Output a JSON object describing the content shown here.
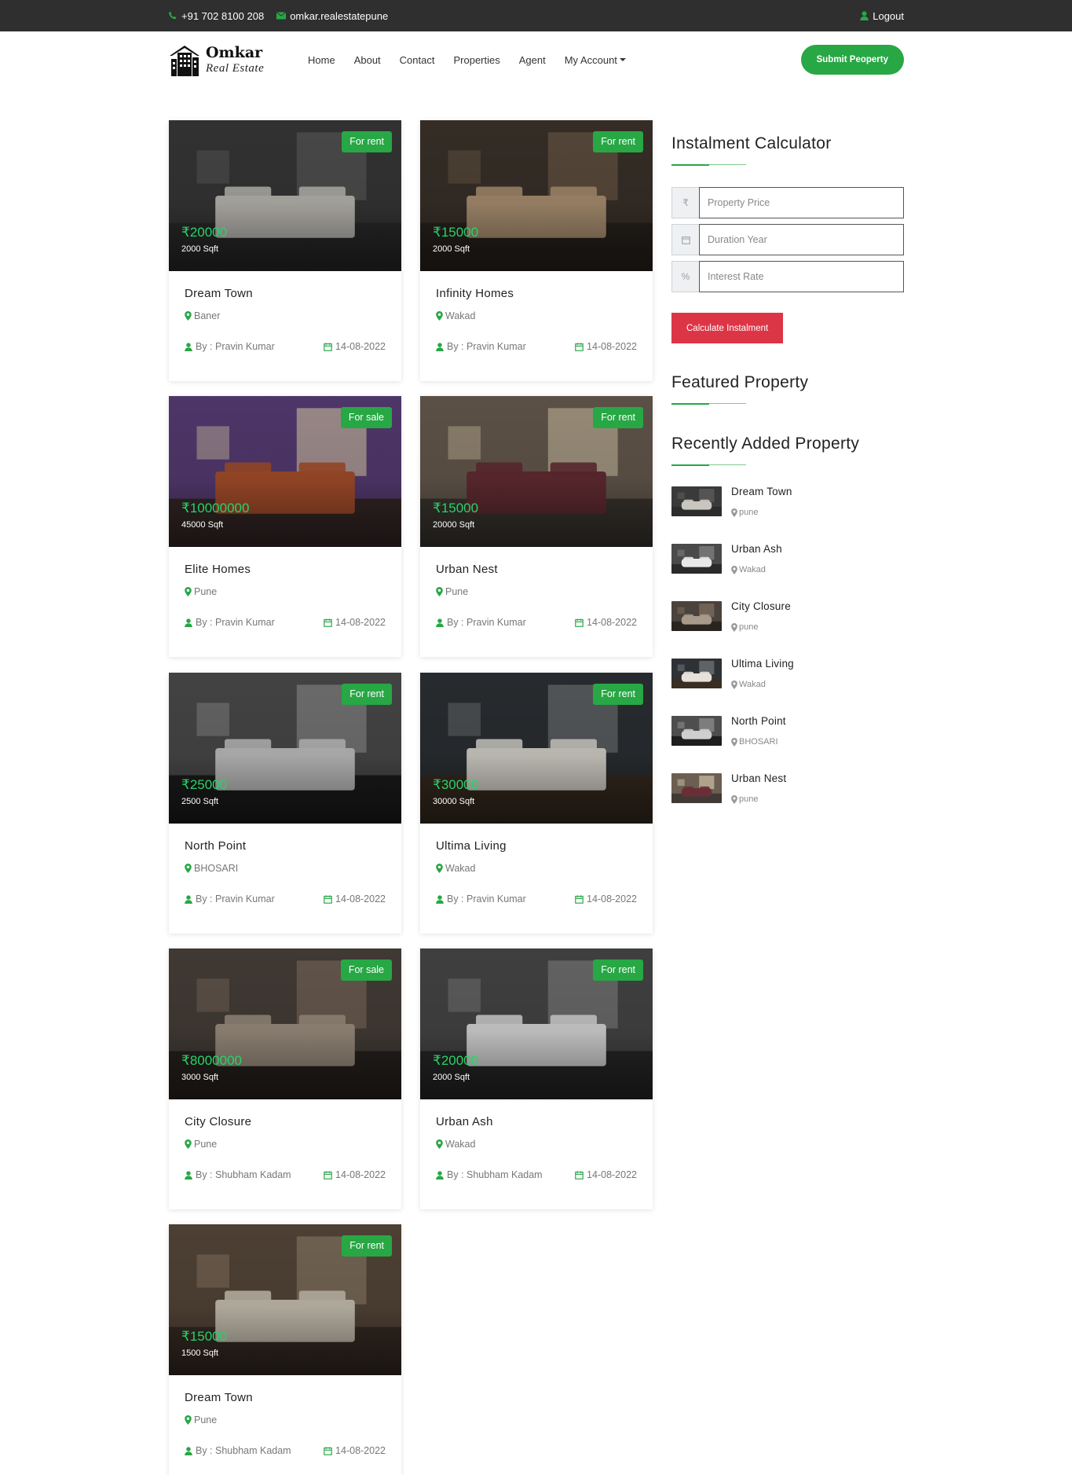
{
  "topbar": {
    "phone": "+91 702 8100 208",
    "email": "omkar.realestatepune",
    "logout": "Logout"
  },
  "header": {
    "brand": "Omkar",
    "brand_sub": "Real Estate",
    "nav": [
      "Home",
      "About",
      "Contact",
      "Properties",
      "Agent",
      "My Account"
    ],
    "submit_label": "Submit Peoperty"
  },
  "properties": [
    {
      "badge": "For rent",
      "price": "₹20000",
      "area": "2000 Sqft",
      "title": "Dream Town",
      "location": "Baner",
      "by": "By : Pravin Kumar",
      "date": "14-08-2022"
    },
    {
      "badge": "For rent",
      "price": "₹15000",
      "area": "2000 Sqft",
      "title": "Infinity Homes",
      "location": "Wakad",
      "by": "By : Pravin Kumar",
      "date": "14-08-2022"
    },
    {
      "badge": "For sale",
      "price": "₹10000000",
      "area": "45000 Sqft",
      "title": "Elite Homes",
      "location": "Pune",
      "by": "By : Pravin Kumar",
      "date": "14-08-2022"
    },
    {
      "badge": "For rent",
      "price": "₹15000",
      "area": "20000 Sqft",
      "title": "Urban Nest",
      "location": "Pune",
      "by": "By : Pravin Kumar",
      "date": "14-08-2022"
    },
    {
      "badge": "For rent",
      "price": "₹25000",
      "area": "2500 Sqft",
      "title": "North Point",
      "location": "BHOSARI",
      "by": "By : Pravin Kumar",
      "date": "14-08-2022"
    },
    {
      "badge": "For rent",
      "price": "₹30000",
      "area": "30000 Sqft",
      "title": "Ultima Living",
      "location": "Wakad",
      "by": "By : Pravin Kumar",
      "date": "14-08-2022"
    },
    {
      "badge": "For sale",
      "price": "₹8000000",
      "area": "3000 Sqft",
      "title": "City Closure",
      "location": "Pune",
      "by": "By : Shubham Kadam",
      "date": "14-08-2022"
    },
    {
      "badge": "For rent",
      "price": "₹20000",
      "area": "2000 Sqft",
      "title": "Urban Ash",
      "location": "Wakad",
      "by": "By : Shubham Kadam",
      "date": "14-08-2022"
    },
    {
      "badge": "For rent",
      "price": "₹15000",
      "area": "1500 Sqft",
      "title": "Dream Town",
      "location": "Pune",
      "by": "By : Shubham Kadam",
      "date": "14-08-2022"
    }
  ],
  "sidebar": {
    "calc_title": "Instalment Calculator",
    "fields": [
      {
        "addon": "₹",
        "placeholder": "Property Price"
      },
      {
        "addon": "▦",
        "placeholder": "Duration Year"
      },
      {
        "addon": "%",
        "placeholder": "Interest Rate"
      }
    ],
    "calc_button": "Calculate Instalment",
    "featured_title": "Featured Property",
    "recent_title": "Recently Added Property",
    "recent": [
      {
        "name": "Dream Town",
        "city": "pune"
      },
      {
        "name": "Urban Ash",
        "city": "Wakad"
      },
      {
        "name": "City Closure",
        "city": "pune"
      },
      {
        "name": "Ultima Living",
        "city": "Wakad"
      },
      {
        "name": "North Point",
        "city": "BHOSARI"
      },
      {
        "name": "Urban Nest",
        "city": "pune"
      }
    ]
  },
  "colors": {
    "accent": "#28a745",
    "price": "#28d36a",
    "danger": "#dc3545",
    "topbar": "#2f2f2f"
  }
}
